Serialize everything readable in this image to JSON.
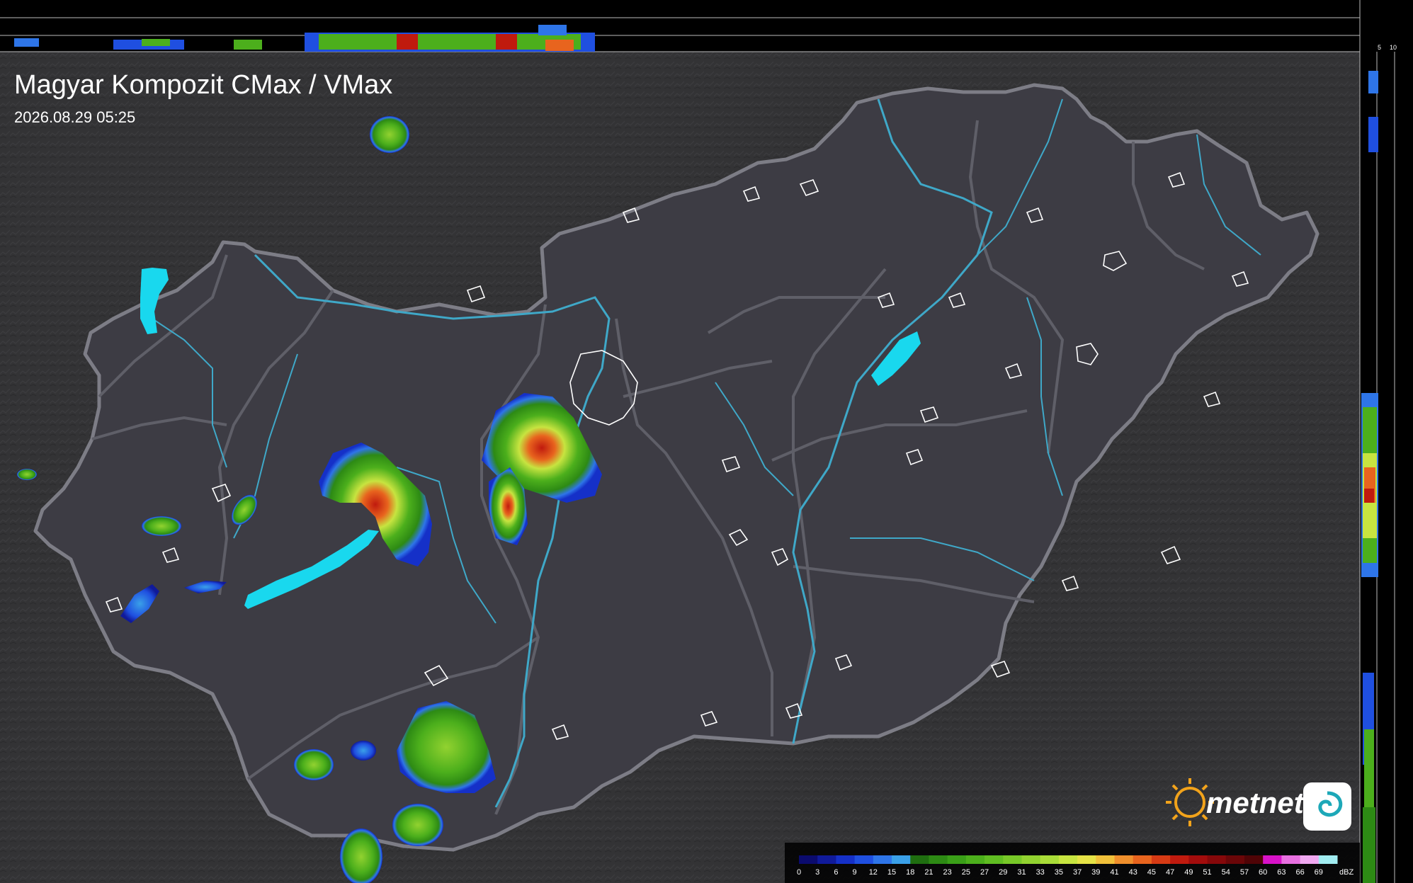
{
  "header": {
    "title": "Magyar Kompozit CMax / VMax",
    "datetime": "2026.08.29 05:25"
  },
  "side_profile": {
    "top_ticks": [
      "10",
      "5"
    ],
    "right_ticks": [
      "5",
      "10"
    ]
  },
  "legend": {
    "unit": "dBZ",
    "ticks": [
      "0",
      "3",
      "6",
      "9",
      "12",
      "15",
      "18",
      "21",
      "23",
      "25",
      "27",
      "29",
      "31",
      "33",
      "35",
      "37",
      "39",
      "41",
      "43",
      "45",
      "47",
      "49",
      "51",
      "54",
      "57",
      "60",
      "63",
      "66",
      "69"
    ],
    "colors": [
      "#0b0b6e",
      "#101a9a",
      "#1530c8",
      "#1f4fe0",
      "#2e75e8",
      "#3aa0e8",
      "#1f6e10",
      "#2d8a14",
      "#3a9f18",
      "#4caf1c",
      "#60bd22",
      "#78c828",
      "#92d230",
      "#a9dc38",
      "#c7e440",
      "#e5e246",
      "#f0c03a",
      "#ef8f2c",
      "#e8641e",
      "#d63a14",
      "#c01a0e",
      "#a20c0c",
      "#86080a",
      "#6a0608",
      "#500406",
      "#d812c8",
      "#e870e0",
      "#f0a8f0",
      "#a0ecf0"
    ]
  },
  "branding": {
    "logo_text": "metnet"
  },
  "colors": {
    "background": "#333333",
    "country_fill": "#3d3c44",
    "border": "#7d7d86",
    "rivers": "#3fa8c8",
    "lakes": "#19d8ee",
    "city_outline": "#ffffff",
    "text": "#ffffff",
    "sun_logo": "#f2a31b"
  }
}
